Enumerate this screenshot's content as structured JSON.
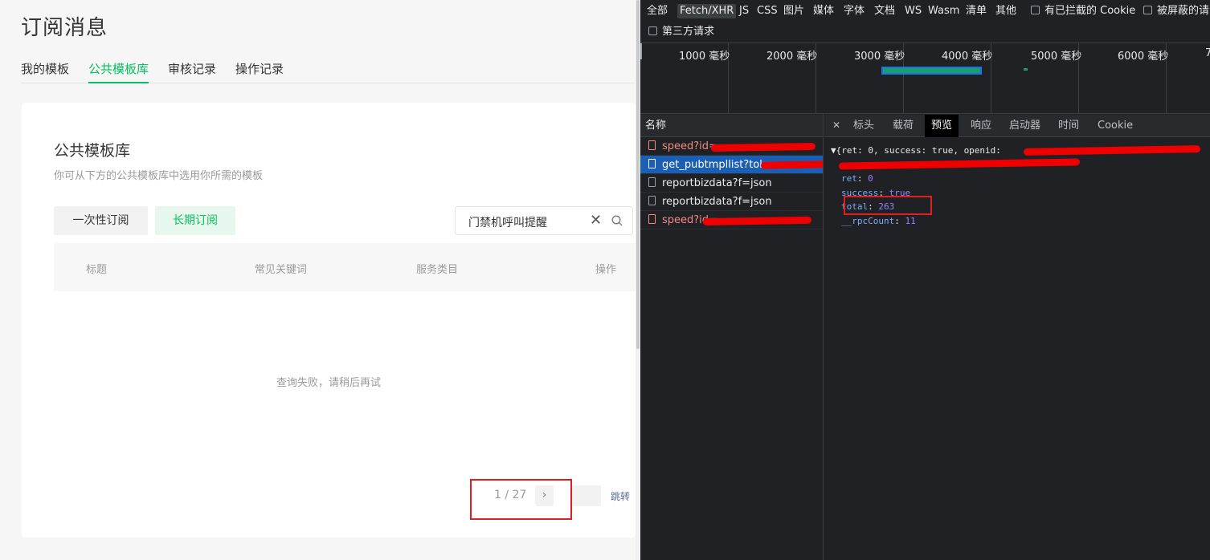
{
  "page": {
    "title": "订阅消息",
    "tabs": [
      "我的模板",
      "公共模板库",
      "审核记录",
      "操作记录"
    ],
    "active_tab": "公共模板库",
    "card_title": "公共模板库",
    "card_desc": "你可从下方的公共模板库中选用你所需的模板",
    "btn_once": "一次性订阅",
    "btn_long": "长期订阅",
    "search_value": "门禁机呼叫提醒",
    "columns": [
      "标题",
      "常见关键词",
      "服务类目",
      "操作"
    ],
    "empty_msg": "查询失败，请稍后再试",
    "pager_text": "1 / 27",
    "pager_next": "›",
    "pager_jump": "跳转"
  },
  "devtools": {
    "filters": [
      "全部",
      "Fetch/XHR",
      "JS",
      "CSS",
      "图片",
      "媒体",
      "字体",
      "文档",
      "WS",
      "Wasm",
      "清单",
      "其他"
    ],
    "active_filter": "Fetch/XHR",
    "chk_blocked_cookies": "有已拦截的 Cookie",
    "chk_blocked_requests": "被屏蔽的请",
    "chk_third_party": "第三方请求",
    "timeline_labels": [
      "1000 毫秒",
      "2000 毫秒",
      "3000 毫秒",
      "4000 毫秒",
      "5000 毫秒",
      "6000 毫秒",
      "7"
    ],
    "name_header": "名称",
    "requests": [
      "speed?id=",
      "get_pubtmpllist?toke",
      "reportbizdata?f=json",
      "reportbizdata?f=json",
      "speed?id="
    ],
    "detail_tabs": [
      "标头",
      "载荷",
      "预览",
      "响应",
      "启动器",
      "时间",
      "Cookie"
    ],
    "active_detail_tab": "预览",
    "json_summary": "▼{ret: 0, success: true, openid:",
    "json_fields": [
      {
        "key": "ret",
        "value": "0"
      },
      {
        "key": "success",
        "value": "true"
      },
      {
        "key": "total",
        "value": "263"
      },
      {
        "key": "__rpcCount",
        "value": "11"
      }
    ]
  },
  "colors": {
    "brand_green": "#07c160",
    "annotation_red": "#e02020"
  }
}
